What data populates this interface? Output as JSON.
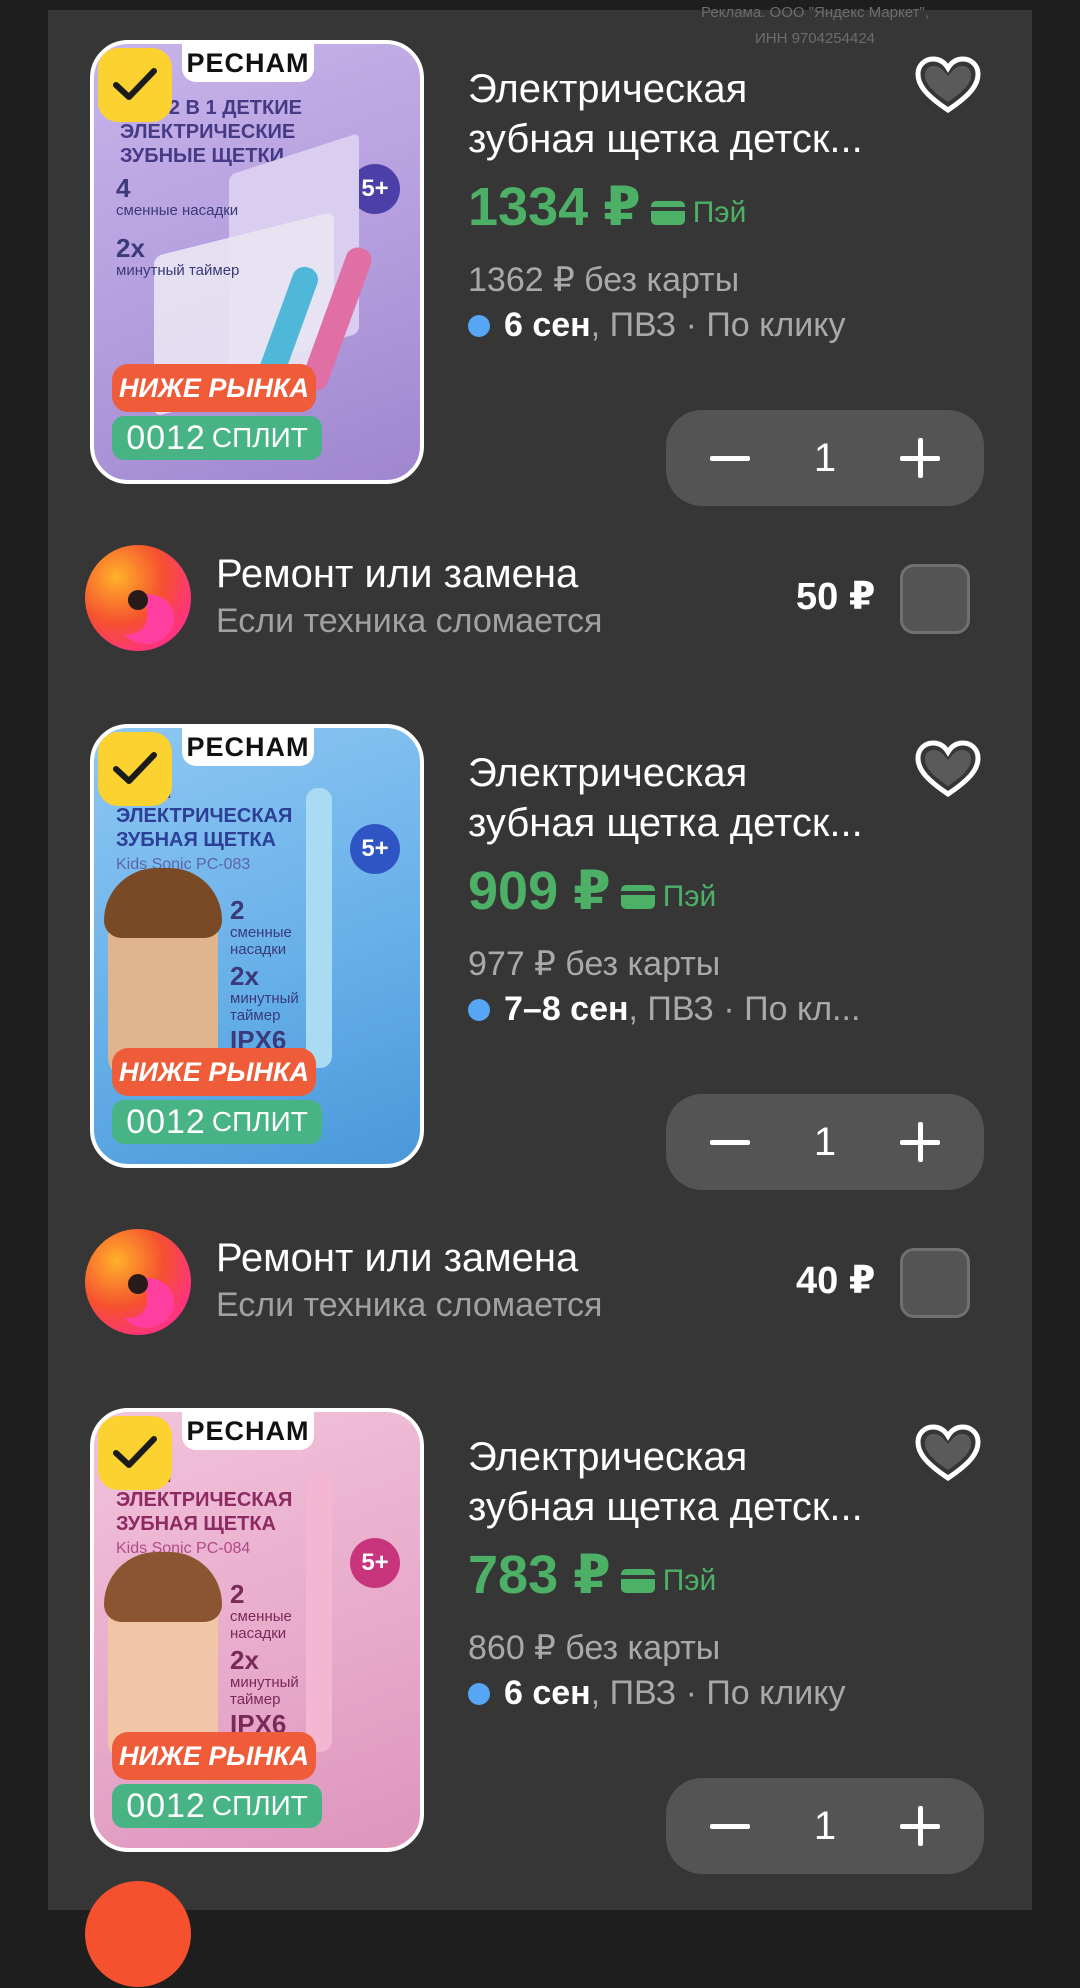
{
  "ad_note": "Реклама. ООО \"Яндекс Маркет\", ИНН 9704254424",
  "colors": {
    "price_green": "#4cb067",
    "accent_yellow": "#fbd230",
    "delivery_dot": "#57a6f4"
  },
  "items": [
    {
      "image_brand": "PECHAM",
      "image_heading": "БОР 2 В 1 ДЕТКИЕ ЭЛЕКТРИЧЕСКИЕ ЗУБНЫЕ ЩЕТКИ",
      "image_badge": "5+",
      "feat1_num": "4",
      "feat1_text": "сменные насадки",
      "feat2_num": "2х",
      "feat2_text": "минутный таймер",
      "promo": "НИЖЕ РЫНКА",
      "split_num": "0012",
      "split_text": "СПЛИТ",
      "title_line1": "Электрическая",
      "title_line2": "зубная щетка детск...",
      "price": "1334 ₽",
      "pay_label": "Пэй",
      "old_price": "1362 ₽ без карты",
      "delivery_date": "6 сен",
      "delivery_rest": ", ПВЗ · По клику",
      "quantity": "1",
      "checked": true
    },
    {
      "image_brand": "PECHAM",
      "image_heading": "СКАЯ ЭЛЕКТРИЧЕСКАЯ ЗУБНАЯ ЩЕТКА",
      "image_model": "Kids Sonic PC-083",
      "image_badge": "5+",
      "feat1_num": "2",
      "feat1_text": "сменные насадки",
      "feat2_num": "2х",
      "feat2_text": "минутный таймер",
      "feat3": "IPX6",
      "promo": "НИЖЕ РЫНКА",
      "split_num": "0012",
      "split_text": "СПЛИТ",
      "title_line1": "Электрическая",
      "title_line2": "зубная щетка детск...",
      "price": "909 ₽",
      "pay_label": "Пэй",
      "old_price": "977 ₽ без карты",
      "delivery_date": "7–8 сен",
      "delivery_rest": ", ПВЗ · По кл...",
      "quantity": "1",
      "checked": true
    },
    {
      "image_brand": "PECHAM",
      "image_heading": "СКАЯ ЭЛЕКТРИЧЕСКАЯ ЗУБНАЯ ЩЕТКА",
      "image_model": "Kids Sonic PC-084",
      "image_badge": "5+",
      "feat1_num": "2",
      "feat1_text": "сменные насадки",
      "feat2_num": "2х",
      "feat2_text": "минутный таймер",
      "feat3": "IPX6",
      "promo": "НИЖЕ РЫНКА",
      "split_num": "0012",
      "split_text": "СПЛИТ",
      "title_line1": "Электрическая",
      "title_line2": "зубная щетка детск...",
      "price": "783 ₽",
      "pay_label": "Пэй",
      "old_price": "860 ₽ без карты",
      "delivery_date": "6 сен",
      "delivery_rest": ", ПВЗ · По клику",
      "quantity": "1",
      "checked": true
    }
  ],
  "services": [
    {
      "title": "Ремонт или замена",
      "subtitle": "Если техника сломается",
      "price": "50 ₽",
      "checked": false
    },
    {
      "title": "Ремонт или замена",
      "subtitle": "Если техника сломается",
      "price": "40 ₽",
      "checked": false
    }
  ]
}
